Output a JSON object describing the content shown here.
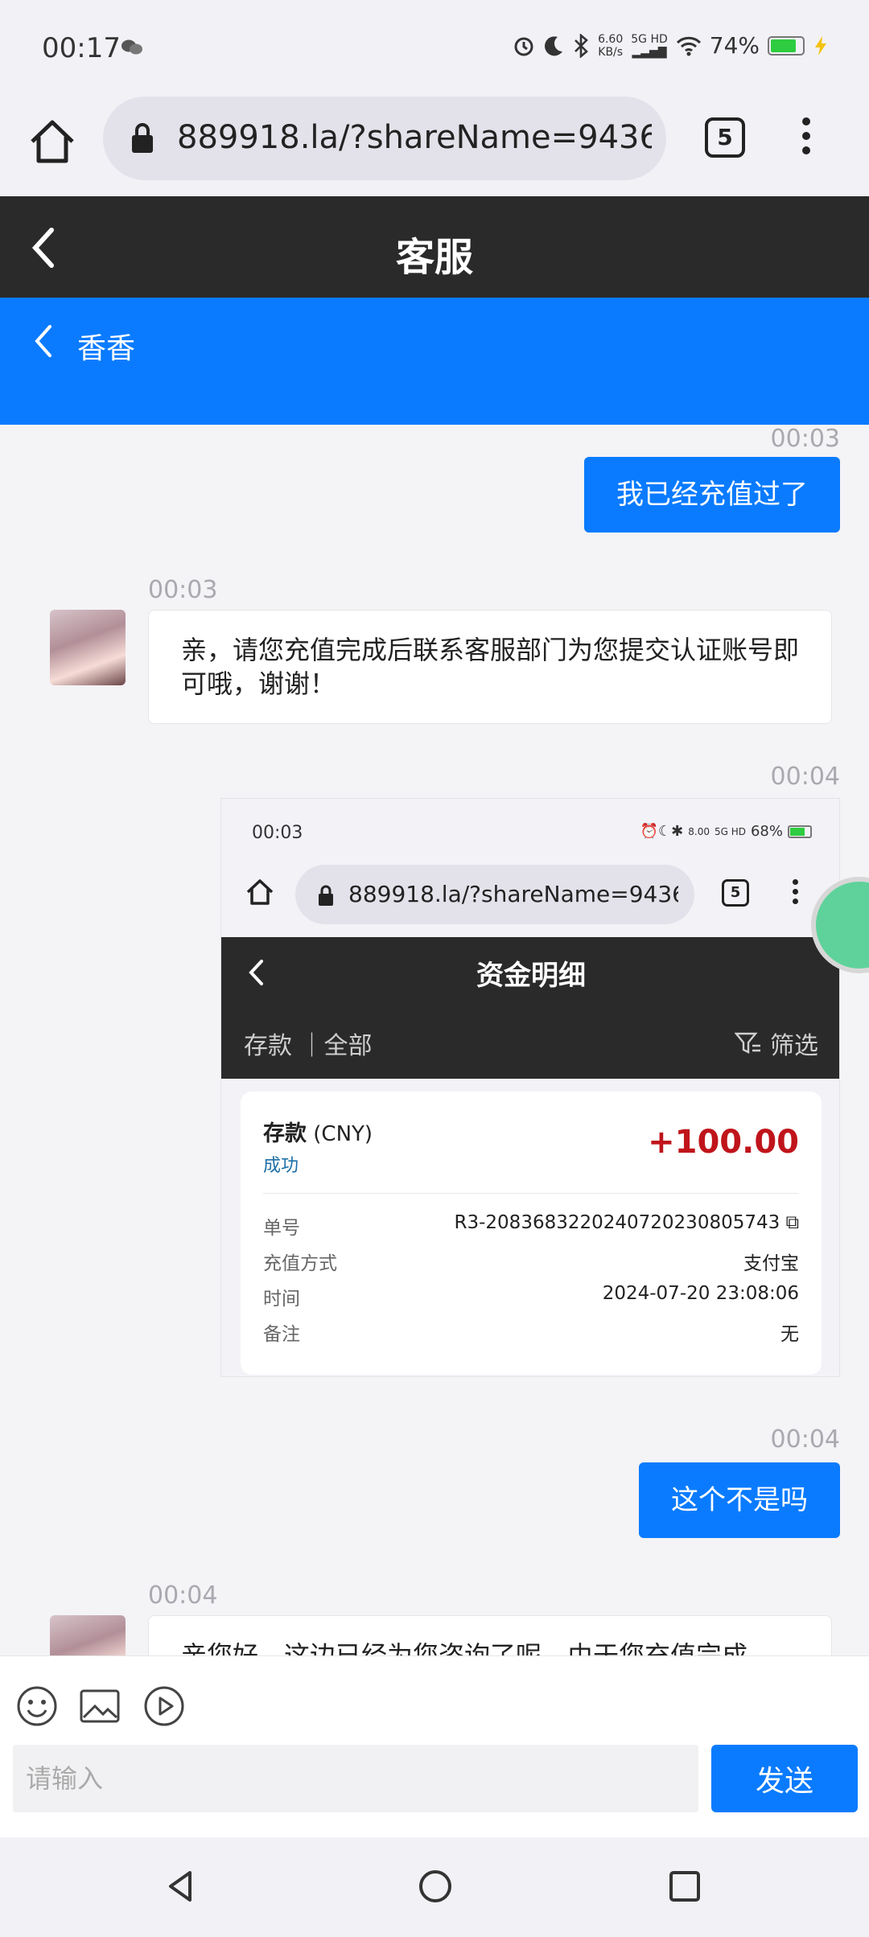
{
  "status_bar": {
    "time": "00:17",
    "net_speed": "6.60",
    "net_unit": "KB/s",
    "net_type": "5G HD",
    "battery": "74%"
  },
  "browser": {
    "url": "889918.la/?shareName=943633.c",
    "tab_count": "5"
  },
  "header": {
    "title": "客服"
  },
  "agent": {
    "name": "香香"
  },
  "messages": [
    {
      "time": "00:03",
      "text": "我已经充值过了"
    },
    {
      "time": "00:03",
      "text": "亲，请您充值完成后联系客服部门为您提交认证账号即可哦，谢谢！"
    },
    {
      "time": "00:04"
    },
    {
      "time": "00:04",
      "text": "这个不是吗"
    },
    {
      "time": "00:04",
      "text": "亲您好，这边已经为您咨询了呢，由于您充值完成"
    }
  ],
  "embedded_screenshot": {
    "time": "00:03",
    "net_speed": "8.00",
    "net_unit": "KB/s",
    "net_type": "5G HD",
    "battery": "68%",
    "url": "889918.la/?shareName=943633.c",
    "tab_count": "5",
    "title": "资金明细",
    "filter_left": "存款 ｜全部",
    "filter_right": "筛选",
    "card": {
      "type": "存款",
      "currency": "(CNY)",
      "status": "成功",
      "amount": "+100.00",
      "rows": [
        {
          "label": "单号",
          "value": "R3-208368322024072023080​5743"
        },
        {
          "label": "充值方式",
          "value": "支付宝"
        },
        {
          "label": "时间",
          "value": "2024-07-20 23:08:06"
        },
        {
          "label": "备注",
          "value": "无"
        }
      ]
    }
  },
  "composer": {
    "placeholder": "请输入",
    "send_label": "发送"
  },
  "colors": {
    "accent": "#0a7bff",
    "header_dark": "#2a2a2a",
    "amount_red": "#c0141b"
  }
}
